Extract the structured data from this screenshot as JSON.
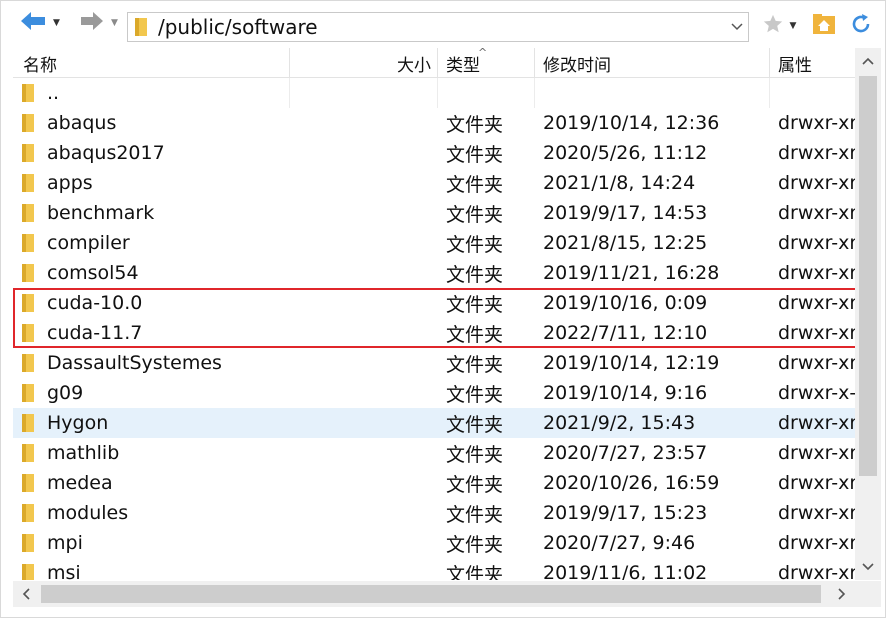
{
  "toolbar": {
    "back_icon": "arrow-left-icon",
    "forward_icon": "arrow-right-icon",
    "dropdown_icon": "caret-down-icon",
    "address_path": "/public/software",
    "address_folder_icon": "folder-icon",
    "favorites_icon": "star-icon",
    "home_icon": "home-folder-icon",
    "refresh_icon": "refresh-icon"
  },
  "columns": {
    "name": "名称",
    "size": "大小",
    "type": "类型",
    "modified": "修改时间",
    "attributes": "属性",
    "sort_indicator": "^"
  },
  "parent_row": {
    "name": ".."
  },
  "rows": [
    {
      "name": "abaqus",
      "size": "",
      "type": "文件夹",
      "modified": "2019/10/14, 12:36",
      "attributes": "drwxr-xr"
    },
    {
      "name": "abaqus2017",
      "size": "",
      "type": "文件夹",
      "modified": "2020/5/26, 11:12",
      "attributes": "drwxr-xr"
    },
    {
      "name": "apps",
      "size": "",
      "type": "文件夹",
      "modified": "2021/1/8, 14:24",
      "attributes": "drwxr-xr"
    },
    {
      "name": "benchmark",
      "size": "",
      "type": "文件夹",
      "modified": "2019/9/17, 14:53",
      "attributes": "drwxr-xr"
    },
    {
      "name": "compiler",
      "size": "",
      "type": "文件夹",
      "modified": "2021/8/15, 12:25",
      "attributes": "drwxr-xr"
    },
    {
      "name": "comsol54",
      "size": "",
      "type": "文件夹",
      "modified": "2019/11/21, 16:28",
      "attributes": "drwxr-xr"
    },
    {
      "name": "cuda-10.0",
      "size": "",
      "type": "文件夹",
      "modified": "2019/10/16, 0:09",
      "attributes": "drwxr-xr"
    },
    {
      "name": "cuda-11.7",
      "size": "",
      "type": "文件夹",
      "modified": "2022/7/11, 12:10",
      "attributes": "drwxr-xr"
    },
    {
      "name": "DassaultSystemes",
      "size": "",
      "type": "文件夹",
      "modified": "2019/10/14, 12:19",
      "attributes": "drwxr-xr"
    },
    {
      "name": "g09",
      "size": "",
      "type": "文件夹",
      "modified": "2019/10/14, 9:16",
      "attributes": "drwxr-x-"
    },
    {
      "name": "Hygon",
      "size": "",
      "type": "文件夹",
      "modified": "2021/9/2, 15:43",
      "attributes": "drwxr-xr"
    },
    {
      "name": "mathlib",
      "size": "",
      "type": "文件夹",
      "modified": "2020/7/27, 23:57",
      "attributes": "drwxr-xr"
    },
    {
      "name": "medea",
      "size": "",
      "type": "文件夹",
      "modified": "2020/10/26, 16:59",
      "attributes": "drwxr-xr"
    },
    {
      "name": "modules",
      "size": "",
      "type": "文件夹",
      "modified": "2019/9/17, 15:23",
      "attributes": "drwxr-xr"
    },
    {
      "name": "mpi",
      "size": "",
      "type": "文件夹",
      "modified": "2020/7/27, 9:46",
      "attributes": "drwxr-xr"
    },
    {
      "name": "msi",
      "size": "",
      "type": "文件夹",
      "modified": "2019/11/6, 11:02",
      "attributes": "drwxr-xr"
    }
  ],
  "selected_row": "Hygon",
  "highlighted_rows": [
    "cuda-10.0",
    "cuda-11.7"
  ],
  "colors": {
    "folder": "#f2c74e",
    "folder_dark": "#dba92a",
    "selection": "#e5f1fb",
    "highlight_border": "#e0262b",
    "nav_arrow": "#3c8dde"
  },
  "scrollbars": {
    "up_arrow": "^",
    "down_arrow": "v",
    "left_arrow": "<",
    "right_arrow": ">"
  }
}
